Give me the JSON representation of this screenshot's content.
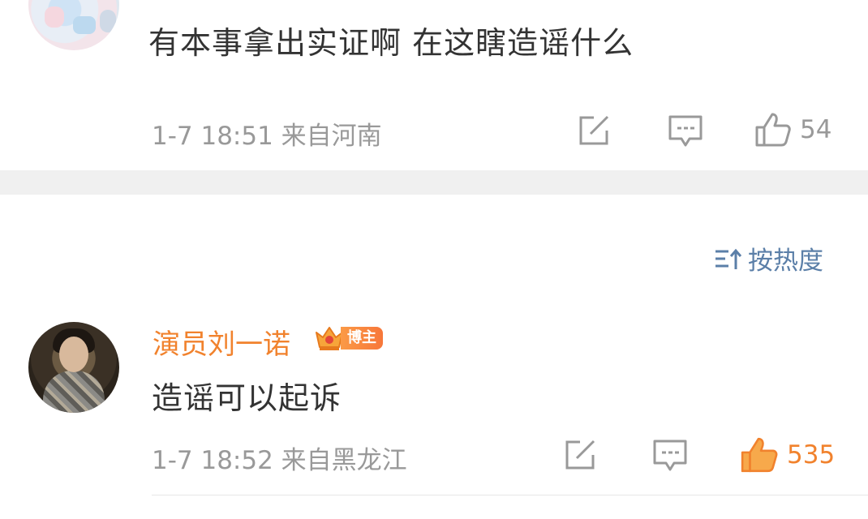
{
  "comment1": {
    "text": "有本事拿出实证啊 在这瞎造谣什么",
    "meta": "1-7 18:51 来自河南",
    "likes": "54"
  },
  "sort": {
    "label": "按热度",
    "icon": "sort-icon"
  },
  "comment2": {
    "username": "演员刘一诺",
    "badge": "博主",
    "text": "造谣可以起诉",
    "meta": "1-7 18:52 来自黑龙江",
    "likes": "535",
    "liked": true
  },
  "icons": {
    "share": "share-icon",
    "comment": "comment-icon",
    "like": "like-icon"
  },
  "colors": {
    "accent": "#f1822d",
    "link": "#5b7fa8",
    "meta": "#999999",
    "text": "#333333"
  }
}
